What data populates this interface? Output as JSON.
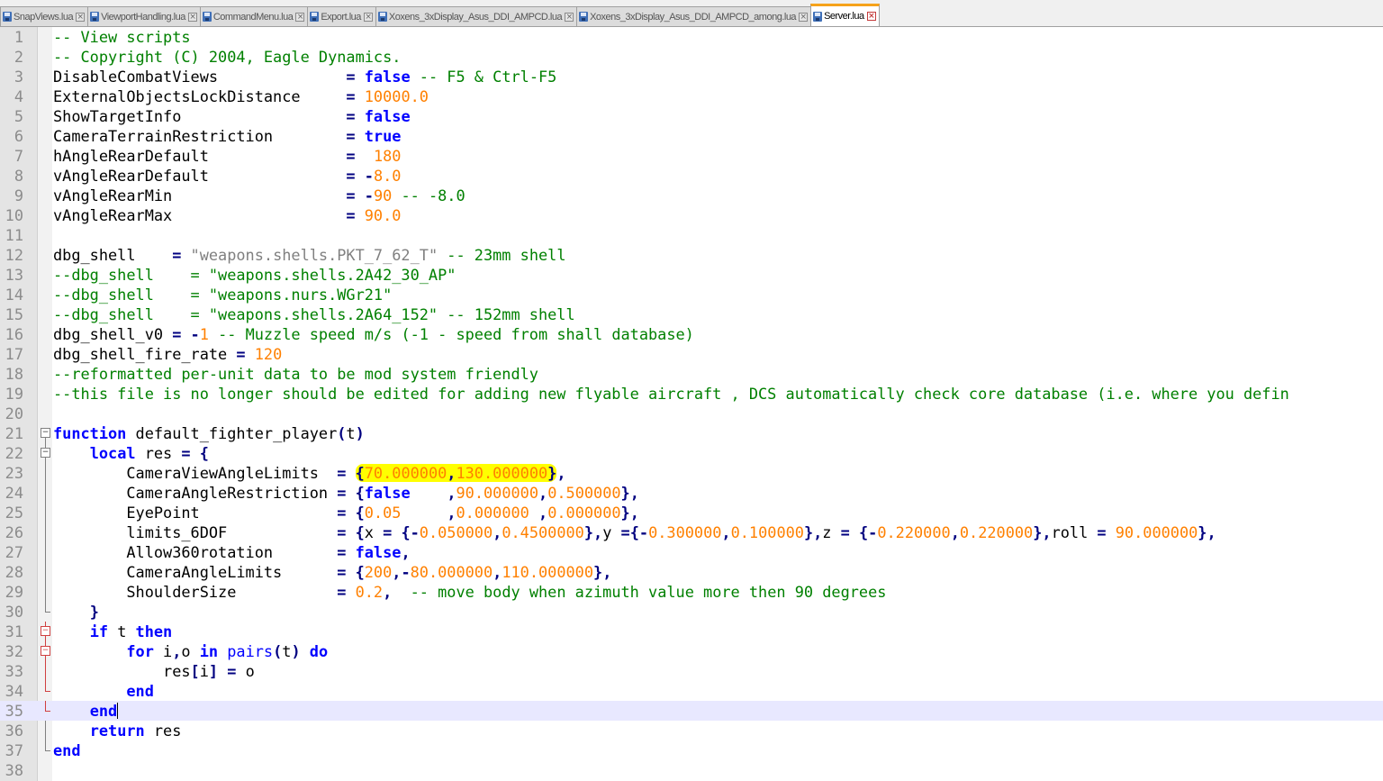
{
  "tabs": [
    {
      "label": "SnapViews.lua",
      "active": false
    },
    {
      "label": "ViewportHandling.lua",
      "active": false
    },
    {
      "label": "CommandMenu.lua",
      "active": false
    },
    {
      "label": "Export.lua",
      "active": false
    },
    {
      "label": "Xoxens_3xDisplay_Asus_DDI_AMPCD.lua",
      "active": false
    },
    {
      "label": "Xoxens_3xDisplay_Asus_DDI_AMPCD_among.lua",
      "active": false
    },
    {
      "label": "Server.lua",
      "active": true
    }
  ],
  "editor": {
    "current_line": 35,
    "highlighted_text": "{70.000000,130.000000}",
    "colors": {
      "comment": "#008000",
      "keyword": "#0000ff",
      "number": "#ff8000",
      "string": "#808080",
      "operator": "#000080",
      "highlight": "#ffff00",
      "current_line": "#e8e8ff"
    },
    "lines": [
      {
        "n": "1",
        "tokens": [
          [
            "c",
            "-- View scripts"
          ]
        ]
      },
      {
        "n": "2",
        "tokens": [
          [
            "c",
            "-- Copyright (C) 2004, Eagle Dynamics."
          ]
        ]
      },
      {
        "n": "3",
        "tokens": [
          [
            "",
            "DisableCombatViews              "
          ],
          [
            "o",
            "="
          ],
          [
            "",
            " "
          ],
          [
            "k",
            "false"
          ],
          [
            "",
            " "
          ],
          [
            "c",
            "-- F5 & Ctrl-F5"
          ]
        ]
      },
      {
        "n": "4",
        "tokens": [
          [
            "",
            "ExternalObjectsLockDistance     "
          ],
          [
            "o",
            "="
          ],
          [
            "",
            " "
          ],
          [
            "n",
            "10000.0"
          ]
        ]
      },
      {
        "n": "5",
        "tokens": [
          [
            "",
            "ShowTargetInfo                  "
          ],
          [
            "o",
            "="
          ],
          [
            "",
            " "
          ],
          [
            "k",
            "false"
          ]
        ]
      },
      {
        "n": "6",
        "tokens": [
          [
            "",
            "CameraTerrainRestriction        "
          ],
          [
            "o",
            "="
          ],
          [
            "",
            " "
          ],
          [
            "k",
            "true"
          ]
        ]
      },
      {
        "n": "7",
        "tokens": [
          [
            "",
            "hAngleRearDefault               "
          ],
          [
            "o",
            "="
          ],
          [
            "",
            "  "
          ],
          [
            "n",
            "180"
          ]
        ]
      },
      {
        "n": "8",
        "tokens": [
          [
            "",
            "vAngleRearDefault               "
          ],
          [
            "o",
            "="
          ],
          [
            "",
            " "
          ],
          [
            "o",
            "-"
          ],
          [
            "n",
            "8.0"
          ]
        ]
      },
      {
        "n": "9",
        "tokens": [
          [
            "",
            "vAngleRearMin                   "
          ],
          [
            "o",
            "="
          ],
          [
            "",
            " "
          ],
          [
            "o",
            "-"
          ],
          [
            "n",
            "90"
          ],
          [
            "",
            " "
          ],
          [
            "c",
            "-- -8.0"
          ]
        ]
      },
      {
        "n": "10",
        "tokens": [
          [
            "",
            "vAngleRearMax                   "
          ],
          [
            "o",
            "="
          ],
          [
            "",
            " "
          ],
          [
            "n",
            "90.0"
          ]
        ]
      },
      {
        "n": "11",
        "tokens": []
      },
      {
        "n": "12",
        "tokens": [
          [
            "",
            "dbg_shell    "
          ],
          [
            "o",
            "="
          ],
          [
            "",
            " "
          ],
          [
            "s",
            "\"weapons.shells.PKT_7_62_T\""
          ],
          [
            "",
            " "
          ],
          [
            "c",
            "-- 23mm shell"
          ]
        ]
      },
      {
        "n": "13",
        "tokens": [
          [
            "c",
            "--dbg_shell    = \"weapons.shells.2A42_30_AP\""
          ]
        ]
      },
      {
        "n": "14",
        "tokens": [
          [
            "c",
            "--dbg_shell    = \"weapons.nurs.WGr21\""
          ]
        ]
      },
      {
        "n": "15",
        "tokens": [
          [
            "c",
            "--dbg_shell    = \"weapons.shells.2A64_152\" -- 152mm shell"
          ]
        ]
      },
      {
        "n": "16",
        "tokens": [
          [
            "",
            "dbg_shell_v0 "
          ],
          [
            "o",
            "="
          ],
          [
            "",
            " "
          ],
          [
            "o",
            "-"
          ],
          [
            "n",
            "1"
          ],
          [
            "",
            " "
          ],
          [
            "c",
            "-- Muzzle speed m/s (-1 - speed from shall database)"
          ]
        ]
      },
      {
        "n": "17",
        "tokens": [
          [
            "",
            "dbg_shell_fire_rate "
          ],
          [
            "o",
            "="
          ],
          [
            "",
            " "
          ],
          [
            "n",
            "120"
          ]
        ]
      },
      {
        "n": "18",
        "tokens": [
          [
            "c",
            "--reformatted per-unit data to be mod system friendly"
          ]
        ]
      },
      {
        "n": "19",
        "tokens": [
          [
            "c",
            "--this file is no longer should be edited for adding new flyable aircraft , DCS automatically check core database (i.e. where you defin"
          ]
        ]
      },
      {
        "n": "20",
        "tokens": []
      },
      {
        "n": "21",
        "fold": "box top",
        "tokens": [
          [
            "k",
            "function"
          ],
          [
            "",
            " default_fighter_player"
          ],
          [
            "o",
            "("
          ],
          [
            "",
            "t"
          ],
          [
            "o",
            ")"
          ]
        ]
      },
      {
        "n": "22",
        "fold": "box mid",
        "tokens": [
          [
            "",
            "    "
          ],
          [
            "k",
            "local"
          ],
          [
            "",
            " res "
          ],
          [
            "o",
            "="
          ],
          [
            "",
            " "
          ],
          [
            "o",
            "{"
          ]
        ]
      },
      {
        "n": "23",
        "fold": "vline",
        "tokens": [
          [
            "",
            "        CameraViewAngleLimits  "
          ],
          [
            "o",
            "="
          ],
          [
            "",
            " "
          ],
          [
            "hl",
            "{70.000000,130.000000}"
          ],
          [
            "o",
            ","
          ]
        ]
      },
      {
        "n": "24",
        "fold": "vline",
        "tokens": [
          [
            "",
            "        CameraAngleRestriction "
          ],
          [
            "o",
            "="
          ],
          [
            "",
            " "
          ],
          [
            "o",
            "{"
          ],
          [
            "k",
            "false"
          ],
          [
            "",
            "    "
          ],
          [
            "o",
            ","
          ],
          [
            "n",
            "90.000000"
          ],
          [
            "o",
            ","
          ],
          [
            "n",
            "0.500000"
          ],
          [
            "o",
            "},"
          ]
        ]
      },
      {
        "n": "25",
        "fold": "vline",
        "tokens": [
          [
            "",
            "        EyePoint               "
          ],
          [
            "o",
            "="
          ],
          [
            "",
            " "
          ],
          [
            "o",
            "{"
          ],
          [
            "n",
            "0.05"
          ],
          [
            "",
            "     "
          ],
          [
            "o",
            ","
          ],
          [
            "n",
            "0.000000"
          ],
          [
            "",
            " "
          ],
          [
            "o",
            ","
          ],
          [
            "n",
            "0.000000"
          ],
          [
            "o",
            "},"
          ]
        ]
      },
      {
        "n": "26",
        "fold": "vline",
        "tokens": [
          [
            "",
            "        limits_6DOF            "
          ],
          [
            "o",
            "="
          ],
          [
            "",
            " "
          ],
          [
            "o",
            "{"
          ],
          [
            "",
            "x "
          ],
          [
            "o",
            "="
          ],
          [
            "",
            " "
          ],
          [
            "o",
            "{-"
          ],
          [
            "n",
            "0.050000"
          ],
          [
            "o",
            ","
          ],
          [
            "n",
            "0.4500000"
          ],
          [
            "o",
            "},"
          ],
          [
            "",
            "y "
          ],
          [
            "o",
            "={-"
          ],
          [
            "n",
            "0.300000"
          ],
          [
            "o",
            ","
          ],
          [
            "n",
            "0.100000"
          ],
          [
            "o",
            "},"
          ],
          [
            "",
            "z "
          ],
          [
            "o",
            "="
          ],
          [
            "",
            " "
          ],
          [
            "o",
            "{-"
          ],
          [
            "n",
            "0.220000"
          ],
          [
            "o",
            ","
          ],
          [
            "n",
            "0.220000"
          ],
          [
            "o",
            "},"
          ],
          [
            "",
            "roll "
          ],
          [
            "o",
            "="
          ],
          [
            "",
            " "
          ],
          [
            "n",
            "90.000000"
          ],
          [
            "o",
            "},"
          ]
        ]
      },
      {
        "n": "27",
        "fold": "vline",
        "tokens": [
          [
            "",
            "        Allow360rotation       "
          ],
          [
            "o",
            "="
          ],
          [
            "",
            " "
          ],
          [
            "k",
            "false"
          ],
          [
            "o",
            ","
          ]
        ]
      },
      {
        "n": "28",
        "fold": "vline",
        "tokens": [
          [
            "",
            "        CameraAngleLimits      "
          ],
          [
            "o",
            "="
          ],
          [
            "",
            " "
          ],
          [
            "o",
            "{"
          ],
          [
            "n",
            "200"
          ],
          [
            "o",
            ",-"
          ],
          [
            "n",
            "80.000000"
          ],
          [
            "o",
            ","
          ],
          [
            "n",
            "110.000000"
          ],
          [
            "o",
            "},"
          ]
        ]
      },
      {
        "n": "29",
        "fold": "vline",
        "tokens": [
          [
            "",
            "        ShoulderSize           "
          ],
          [
            "o",
            "="
          ],
          [
            "",
            " "
          ],
          [
            "n",
            "0.2"
          ],
          [
            "o",
            ","
          ],
          [
            "",
            "  "
          ],
          [
            "c",
            "-- move body when azimuth value more then 90 degrees"
          ]
        ]
      },
      {
        "n": "30",
        "fold": "end",
        "tokens": [
          [
            "",
            "    "
          ],
          [
            "o",
            "}"
          ]
        ]
      },
      {
        "n": "31",
        "fold": "box red mid",
        "tokens": [
          [
            "",
            "    "
          ],
          [
            "k",
            "if"
          ],
          [
            "",
            " t "
          ],
          [
            "k",
            "then"
          ]
        ]
      },
      {
        "n": "32",
        "fold": "box red mid",
        "tokens": [
          [
            "",
            "        "
          ],
          [
            "k",
            "for"
          ],
          [
            "",
            " i"
          ],
          [
            "o",
            ","
          ],
          [
            "",
            "o "
          ],
          [
            "k",
            "in"
          ],
          [
            "",
            " "
          ],
          [
            "f",
            "pairs"
          ],
          [
            "o",
            "("
          ],
          [
            "",
            "t"
          ],
          [
            "o",
            ")"
          ],
          [
            "",
            " "
          ],
          [
            "k",
            "do"
          ]
        ]
      },
      {
        "n": "33",
        "fold": "vline red",
        "tokens": [
          [
            "",
            "            res"
          ],
          [
            "o",
            "["
          ],
          [
            "",
            "i"
          ],
          [
            "o",
            "]"
          ],
          [
            "",
            " "
          ],
          [
            "o",
            "="
          ],
          [
            "",
            " o"
          ]
        ]
      },
      {
        "n": "34",
        "fold": "end red",
        "tokens": [
          [
            "",
            "        "
          ],
          [
            "k",
            "end"
          ]
        ]
      },
      {
        "n": "35",
        "fold": "end red",
        "tokens": [
          [
            "",
            "    "
          ],
          [
            "k",
            "end"
          ],
          [
            "caret",
            ""
          ]
        ]
      },
      {
        "n": "36",
        "fold": "vline",
        "tokens": [
          [
            "",
            "    "
          ],
          [
            "k",
            "return"
          ],
          [
            "",
            " res"
          ]
        ]
      },
      {
        "n": "37",
        "fold": "end",
        "tokens": [
          [
            "k",
            "end"
          ]
        ]
      },
      {
        "n": "38",
        "tokens": []
      }
    ]
  }
}
